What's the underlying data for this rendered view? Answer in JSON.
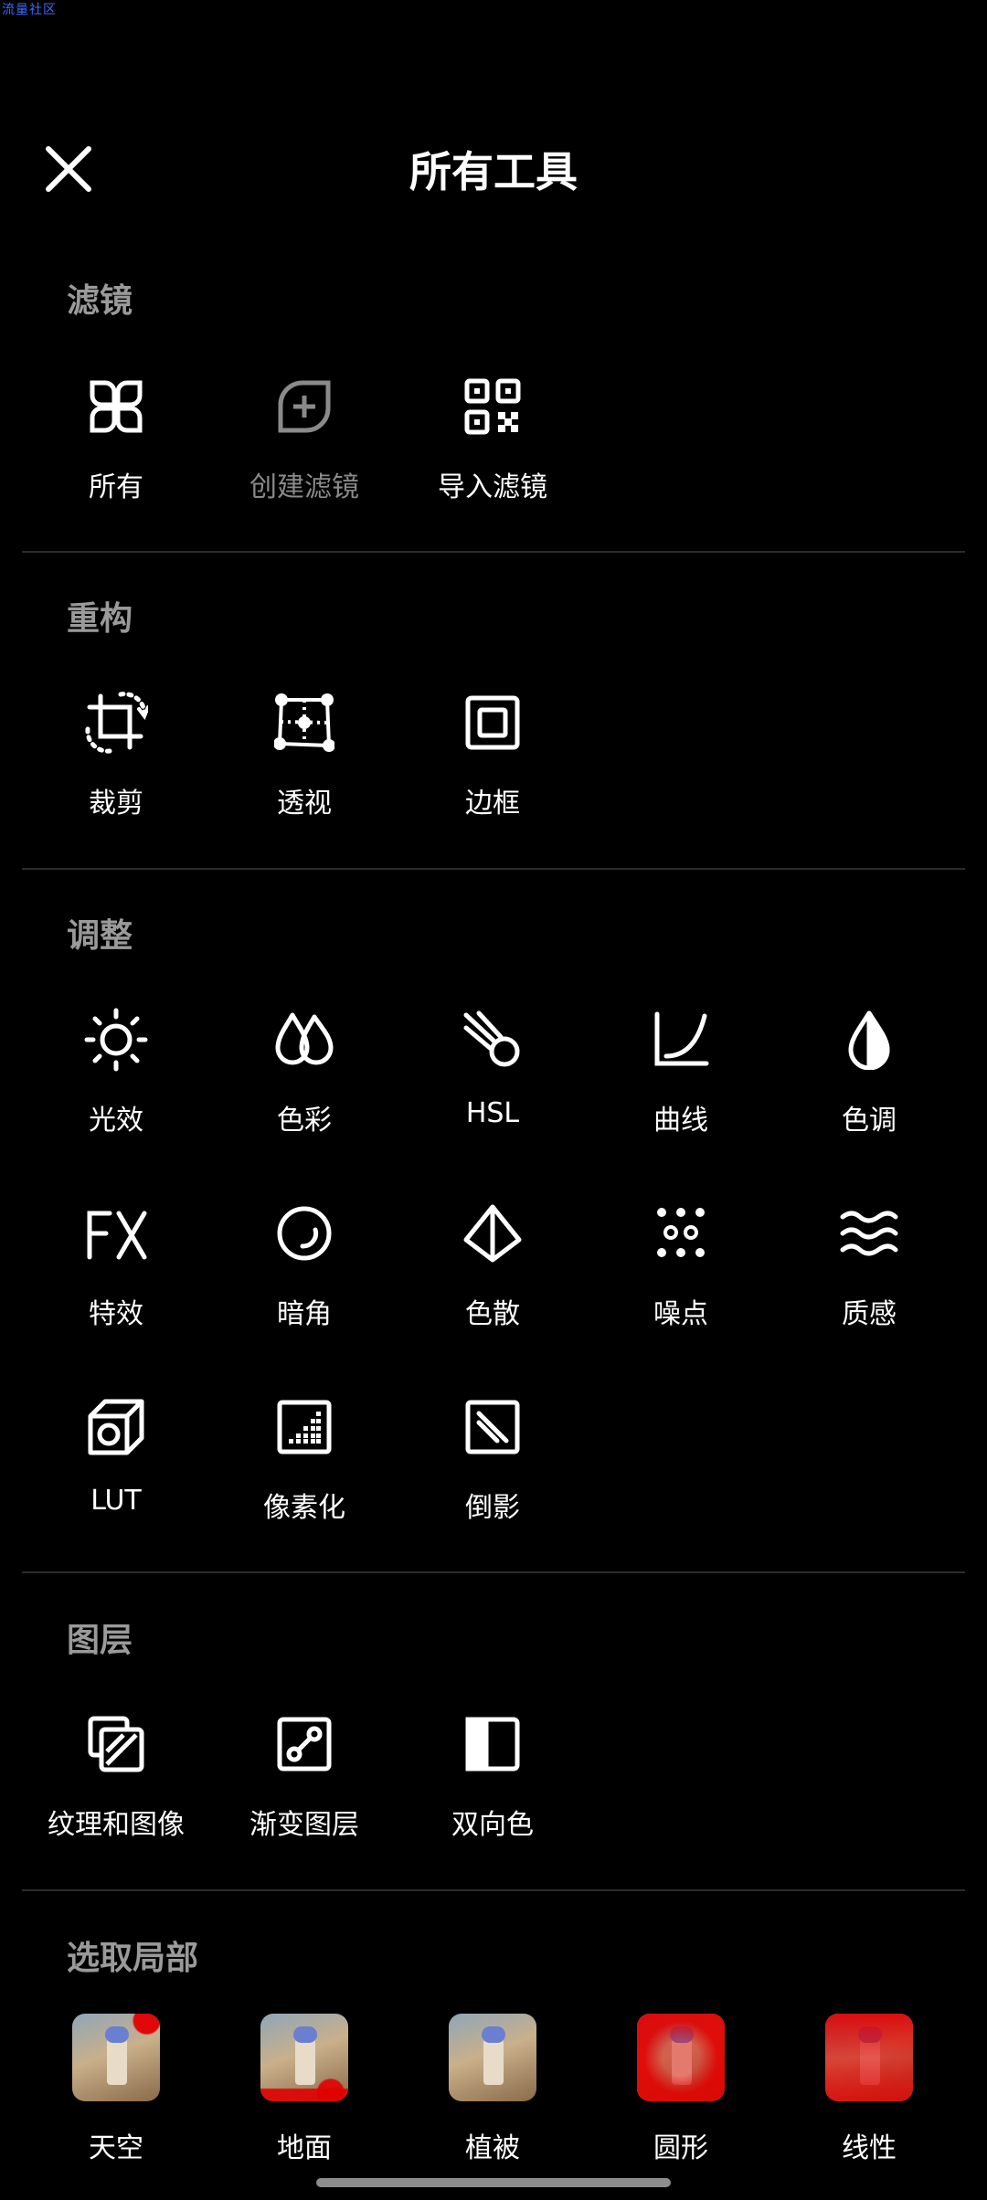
{
  "watermark": "流量社区",
  "header": {
    "title": "所有工具"
  },
  "sections": {
    "filters": {
      "title": "滤镜",
      "items": [
        "所有",
        "创建滤镜",
        "导入滤镜"
      ]
    },
    "restructure": {
      "title": "重构",
      "items": [
        "裁剪",
        "透视",
        "边框"
      ]
    },
    "adjust": {
      "title": "调整",
      "items": [
        "光效",
        "色彩",
        "HSL",
        "曲线",
        "色调",
        "特效",
        "暗角",
        "色散",
        "噪点",
        "质感",
        "LUT",
        "像素化",
        "倒影"
      ]
    },
    "layers": {
      "title": "图层",
      "items": [
        "纹理和图像",
        "渐变图层",
        "双向色"
      ]
    },
    "select": {
      "title": "选取局部",
      "items": [
        "天空",
        "地面",
        "植被",
        "圆形",
        "线性"
      ]
    }
  },
  "colors": {
    "background": "#000000",
    "section_title": "#9a9a9a",
    "disabled": "#8a8a8a",
    "mask_red": "#e00000"
  }
}
